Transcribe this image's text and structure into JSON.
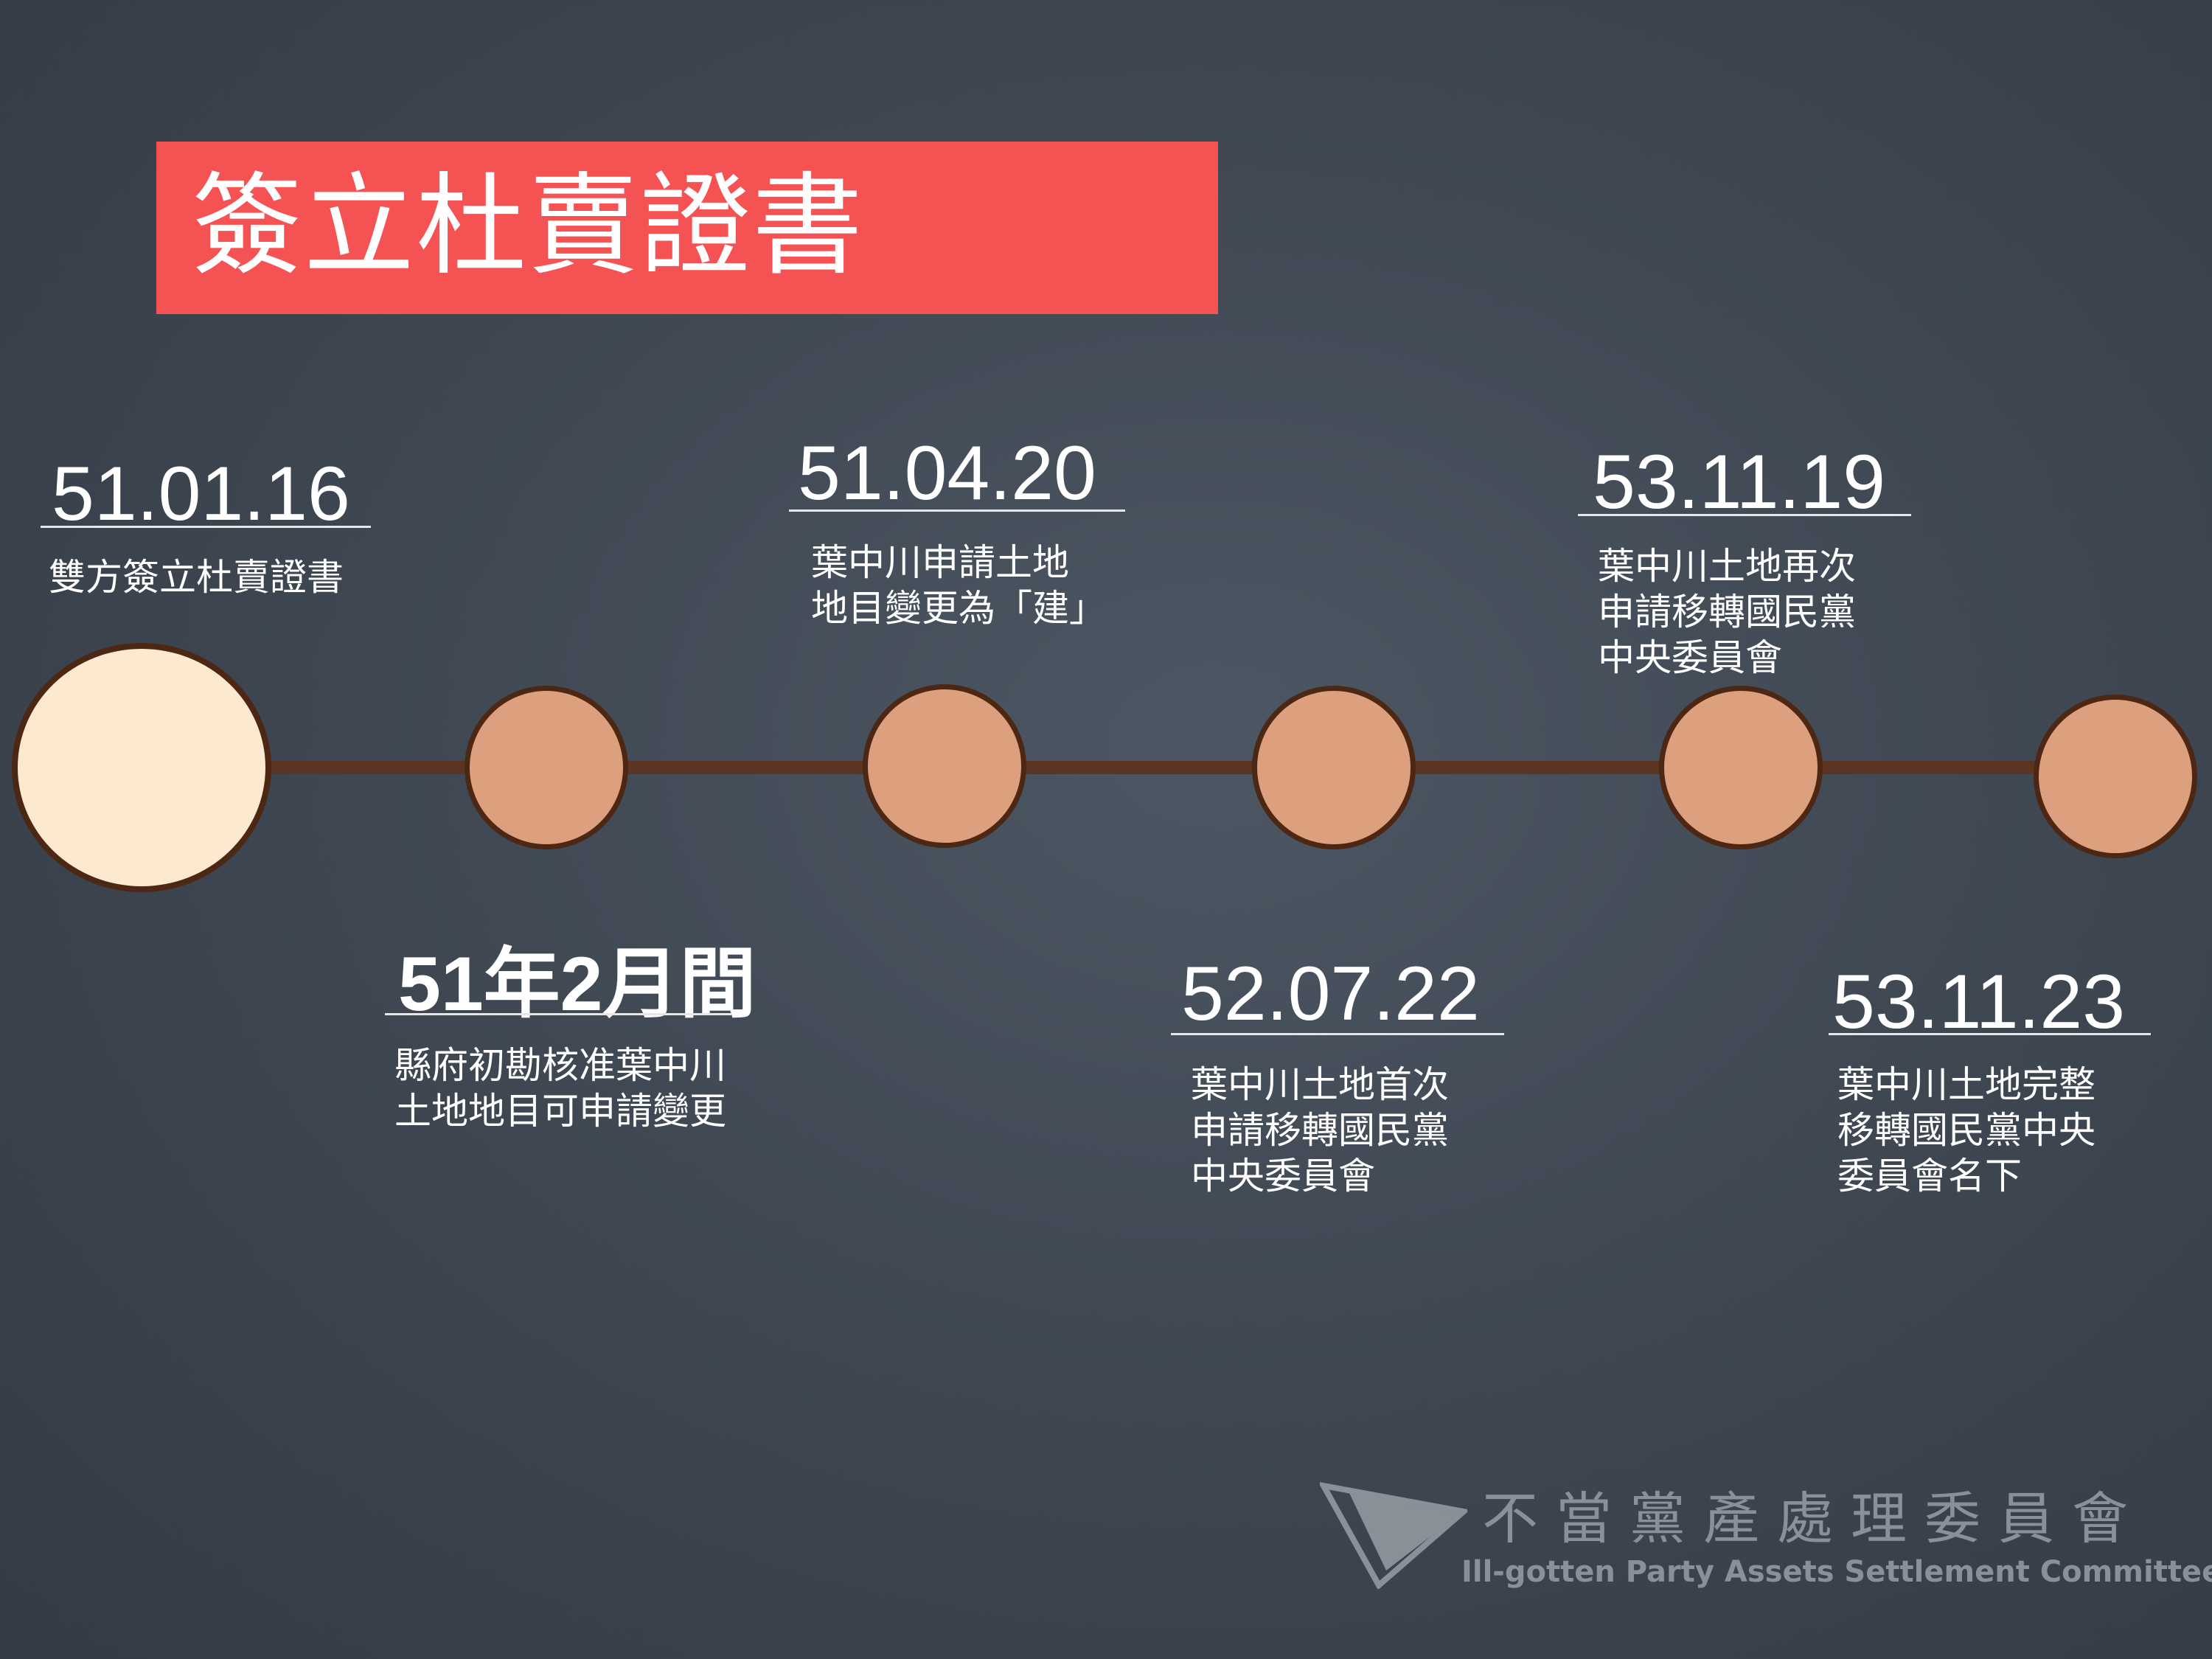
{
  "title": "簽立杜賣證書",
  "events": [
    {
      "date": "51.01.16",
      "lines": [
        "雙方簽立杜賣證書"
      ]
    },
    {
      "date": "51年2月間",
      "lines": [
        "縣府初勘核准葉中川",
        "土地地目可申請變更"
      ]
    },
    {
      "date": "51.04.20",
      "lines": [
        "葉中川申請土地",
        "地目變更為「建」"
      ]
    },
    {
      "date": "52.07.22",
      "lines": [
        "葉中川土地首次",
        "申請移轉國民黨",
        "中央委員會"
      ]
    },
    {
      "date": "53.11.19",
      "lines": [
        "葉中川土地再次",
        "申請移轉國民黨",
        "中央委員會"
      ]
    },
    {
      "date": "53.11.23",
      "lines": [
        "葉中川土地完整",
        "移轉國民黨中央",
        "委員會名下"
      ]
    }
  ],
  "logo": {
    "name_zh": "不當黨產處理委員會",
    "name_en": "Ill-gotten Party Assets Settlement Committee"
  },
  "colors": {
    "title_box": "#f55253",
    "node_fill": "#dda07e",
    "node_start_fill": "#fde8d0",
    "node_border": "#4b2714",
    "axis": "#5b3522"
  }
}
